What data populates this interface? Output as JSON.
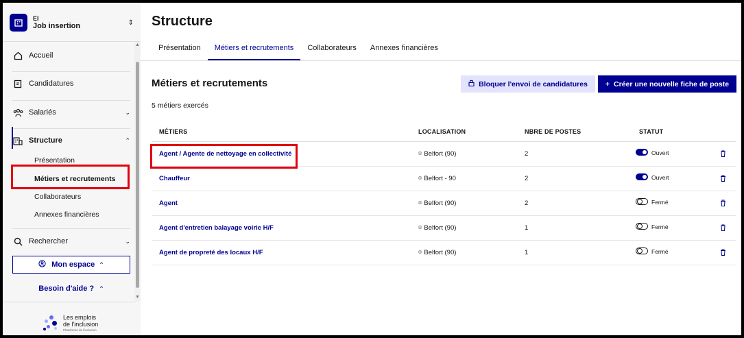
{
  "org": {
    "type": "EI",
    "name": "Job insertion"
  },
  "nav": {
    "accueil": "Accueil",
    "candidatures": "Candidatures",
    "salaries": "Salariés",
    "structure": "Structure",
    "sub": [
      "Présentation",
      "Métiers et recrutements",
      "Collaborateurs",
      "Annexes financières"
    ],
    "rechercher": "Rechercher"
  },
  "account": {
    "mon_espace": "Mon espace",
    "besoin_aide": "Besoin d'aide ?"
  },
  "brand": {
    "line1": "Les emplois",
    "line2": "de l'inclusion",
    "tagline": "Plateforme de l'inclusion"
  },
  "page": {
    "title": "Structure"
  },
  "tabs": [
    "Présentation",
    "Métiers et recrutements",
    "Collaborateurs",
    "Annexes financières"
  ],
  "section": {
    "title": "Métiers et recrutements",
    "count": "5 métiers exercés",
    "block_button": "Bloquer l'envoi de candidatures",
    "create_button": "Créer une nouvelle fiche de poste"
  },
  "table": {
    "headers": [
      "MÉTIERS",
      "LOCALISATION",
      "NBRE DE POSTES",
      "STATUT"
    ],
    "rows": [
      {
        "job": "Agent / Agente de nettoyage en collectivité",
        "location": "Belfort (90)",
        "posts": "2",
        "status": "Ouvert",
        "open": true
      },
      {
        "job": "Chauffeur",
        "location": "Belfort - 90",
        "posts": "2",
        "status": "Ouvert",
        "open": true
      },
      {
        "job": "Agent",
        "location": "Belfort (90)",
        "posts": "2",
        "status": "Fermé",
        "open": false
      },
      {
        "job": "Agent d'entretien balayage voirie H/F",
        "location": "Belfort (90)",
        "posts": "1",
        "status": "Fermé",
        "open": false
      },
      {
        "job": "Agent de propreté des locaux H/F",
        "location": "Belfort (90)",
        "posts": "1",
        "status": "Fermé",
        "open": false
      }
    ]
  },
  "colors": {
    "primary": "#000091",
    "highlight": "#e1000f",
    "secondary_bg": "#e3e3fd"
  }
}
